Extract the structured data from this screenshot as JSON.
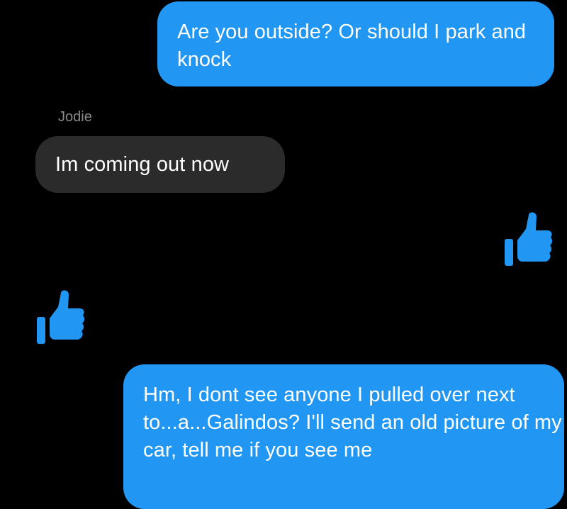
{
  "conversation": {
    "messages": [
      {
        "direction": "outgoing",
        "text": "Are you outside? Or should I park and knock"
      },
      {
        "direction": "incoming",
        "sender": "Jodie",
        "text": "Im coming out now"
      },
      {
        "direction": "outgoing",
        "text": "Hm, I dont see anyone I pulled over next to...a...Galindos? I'll send an old picture of my car, tell me if you see me"
      }
    ],
    "reactions": [
      {
        "type": "thumbs-up",
        "side": "outgoing"
      },
      {
        "type": "thumbs-up",
        "side": "incoming"
      }
    ]
  },
  "colors": {
    "background": "#000000",
    "outgoing_bubble": "#2196f3",
    "incoming_bubble": "#2b2b2b",
    "text": "#ffffff",
    "sender_name": "#8a8a8a",
    "like_icon": "#2196f3"
  }
}
